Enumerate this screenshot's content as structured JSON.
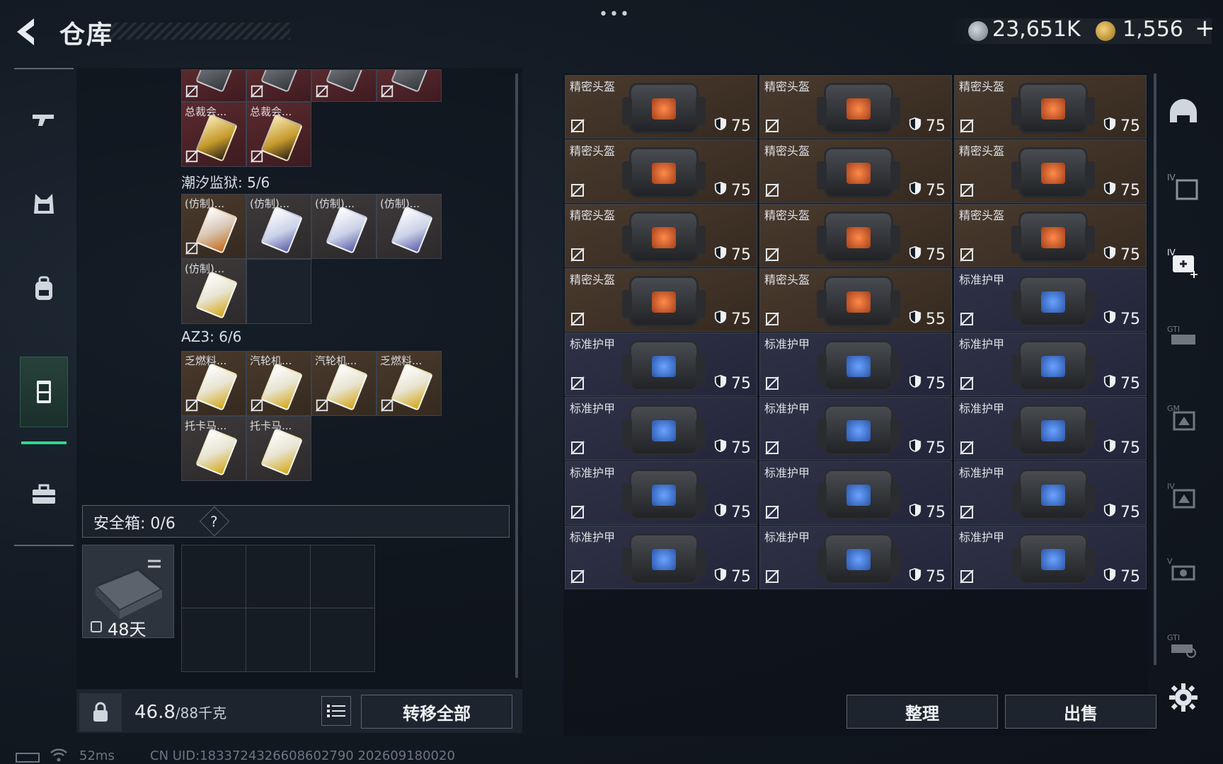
{
  "header": {
    "title": "仓库",
    "more": "•••",
    "money": "23,651K",
    "gold": "1,556",
    "plus": "+",
    "colors": {
      "accent": "#2fd78a",
      "helmet_bg": "#4a3a2e",
      "armor_bg": "#2f3246",
      "red_bg": "#5a2a2e"
    }
  },
  "left_nav": {
    "items": [
      {
        "name": "weapons",
        "icon": "gun-icon"
      },
      {
        "name": "armor",
        "icon": "vest-icon"
      },
      {
        "name": "backpack",
        "icon": "backpack-icon"
      },
      {
        "name": "stash",
        "icon": "locker-icon",
        "active": true
      },
      {
        "name": "toolbox",
        "icon": "briefcase-icon"
      }
    ]
  },
  "stash": {
    "top_row": [
      "",
      "",
      "",
      ""
    ],
    "row2": [
      {
        "name": "总裁会..."
      },
      {
        "name": "总裁会..."
      }
    ],
    "group1": {
      "label": "潮汐监狱: 5/6",
      "items": [
        {
          "name": "(仿制)..."
        },
        {
          "name": "(仿制)..."
        },
        {
          "name": "(仿制)..."
        },
        {
          "name": "(仿制)..."
        },
        {
          "name": "(仿制)..."
        }
      ]
    },
    "group2": {
      "label": "AZ3: 6/6",
      "items": [
        {
          "name": "乏燃料..."
        },
        {
          "name": "汽轮机..."
        },
        {
          "name": "汽轮机..."
        },
        {
          "name": "乏燃料..."
        },
        {
          "name": "托卡马..."
        },
        {
          "name": "托卡马..."
        }
      ]
    },
    "safe": {
      "label": "安全箱: 0/6",
      "help": "?",
      "days": "48天"
    },
    "weight": {
      "current": "46.8",
      "max": "/88千克"
    },
    "transfer_all": "转移全部"
  },
  "items_grid": [
    {
      "name": "精密头盔",
      "durability": "75",
      "type": "helmet"
    },
    {
      "name": "精密头盔",
      "durability": "75",
      "type": "helmet"
    },
    {
      "name": "精密头盔",
      "durability": "75",
      "type": "helmet"
    },
    {
      "name": "精密头盔",
      "durability": "75",
      "type": "helmet"
    },
    {
      "name": "精密头盔",
      "durability": "75",
      "type": "helmet"
    },
    {
      "name": "精密头盔",
      "durability": "75",
      "type": "helmet"
    },
    {
      "name": "精密头盔",
      "durability": "75",
      "type": "helmet"
    },
    {
      "name": "精密头盔",
      "durability": "75",
      "type": "helmet"
    },
    {
      "name": "精密头盔",
      "durability": "75",
      "type": "helmet"
    },
    {
      "name": "精密头盔",
      "durability": "75",
      "type": "helmet"
    },
    {
      "name": "精密头盔",
      "durability": "55",
      "type": "helmet"
    },
    {
      "name": "标准护甲",
      "durability": "75",
      "type": "armor"
    },
    {
      "name": "标准护甲",
      "durability": "75",
      "type": "armor"
    },
    {
      "name": "标准护甲",
      "durability": "75",
      "type": "armor"
    },
    {
      "name": "标准护甲",
      "durability": "75",
      "type": "armor"
    },
    {
      "name": "标准护甲",
      "durability": "75",
      "type": "armor"
    },
    {
      "name": "标准护甲",
      "durability": "75",
      "type": "armor"
    },
    {
      "name": "标准护甲",
      "durability": "75",
      "type": "armor"
    },
    {
      "name": "标准护甲",
      "durability": "75",
      "type": "armor"
    },
    {
      "name": "标准护甲",
      "durability": "75",
      "type": "armor"
    },
    {
      "name": "标准护甲",
      "durability": "75",
      "type": "armor"
    },
    {
      "name": "标准护甲",
      "durability": "75",
      "type": "armor"
    },
    {
      "name": "标准护甲",
      "durability": "75",
      "type": "armor"
    },
    {
      "name": "标准护甲",
      "durability": "75",
      "type": "armor"
    }
  ],
  "actions": {
    "sort": "整理",
    "sell": "出售"
  },
  "right_rail": [
    {
      "icon": "helmet-filter-icon"
    },
    {
      "icon": "armor-iv-filter-icon"
    },
    {
      "icon": "medkit-iv-filter-icon",
      "active": true
    },
    {
      "icon": "gti-filter-icon"
    },
    {
      "icon": "gm-filter-icon"
    },
    {
      "icon": "iv-filter-icon"
    },
    {
      "icon": "v-filter-icon"
    },
    {
      "icon": "gti-2-filter-icon"
    }
  ],
  "status": {
    "ping": "52ms",
    "uid": "CN UID:1833724326608602790 202609180020"
  }
}
